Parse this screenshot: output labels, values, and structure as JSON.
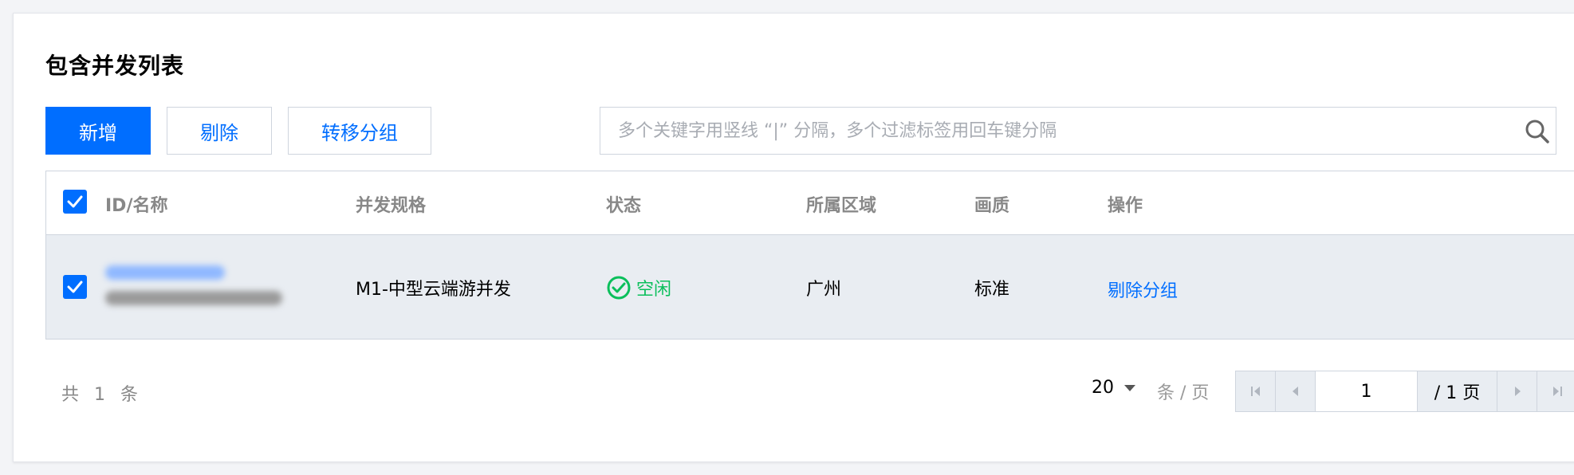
{
  "panel": {
    "title": "包含并发列表"
  },
  "toolbar": {
    "add_label": "新增",
    "remove_label": "剔除",
    "move_group_label": "转移分组"
  },
  "search": {
    "placeholder": "多个关键字用竖线 “|” 分隔，多个过滤标签用回车键分隔",
    "value": ""
  },
  "table": {
    "columns": [
      "ID/名称",
      "并发规格",
      "状态",
      "所属区域",
      "画质",
      "操作"
    ],
    "rows": [
      {
        "checked": true,
        "spec": "M1-中型云端游并发",
        "status": "空闲",
        "region": "广州",
        "quality": "标准",
        "action": "剔除分组"
      }
    ],
    "header_checked": true
  },
  "pagination": {
    "total_text": "共 1 条",
    "page_size": "20",
    "per_page_text": "条 / 页",
    "current_page": "1",
    "total_pages_text": "/ 1 页"
  },
  "colors": {
    "primary": "#006eff",
    "success": "#0abf5b",
    "border": "#cfd5de",
    "row_bg": "#e9edf2"
  },
  "icons": {
    "search": "search-icon",
    "status": "check-circle-icon",
    "first": "first-page-icon",
    "prev": "prev-page-icon",
    "next": "next-page-icon",
    "last": "last-page-icon"
  }
}
